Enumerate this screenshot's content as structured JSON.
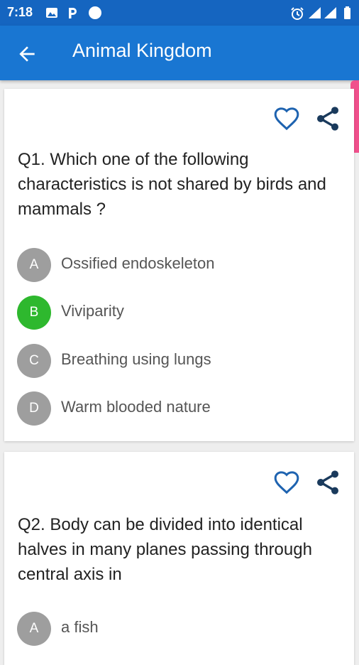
{
  "status_bar": {
    "time": "7:18"
  },
  "header": {
    "title": "Animal Kingdom"
  },
  "colors": {
    "primary": "#1976d2",
    "status": "#1565c0",
    "correct": "#2eb82e",
    "option_badge": "#9e9e9e",
    "scroll_accent": "#f0508c"
  },
  "questions": [
    {
      "text": "Q1. Which one of the following characteristics is not shared by birds and mammals ?",
      "options": [
        {
          "letter": "A",
          "text": "Ossified endoskeleton"
        },
        {
          "letter": "B",
          "text": "Viviparity",
          "correct": true
        },
        {
          "letter": "C",
          "text": "Breathing using lungs"
        },
        {
          "letter": "D",
          "text": "Warm blooded nature"
        }
      ]
    },
    {
      "text": "Q2. Body can be divided into identical halves in many planes passing through central axis in",
      "options": [
        {
          "letter": "A",
          "text": "a fish"
        }
      ]
    }
  ]
}
